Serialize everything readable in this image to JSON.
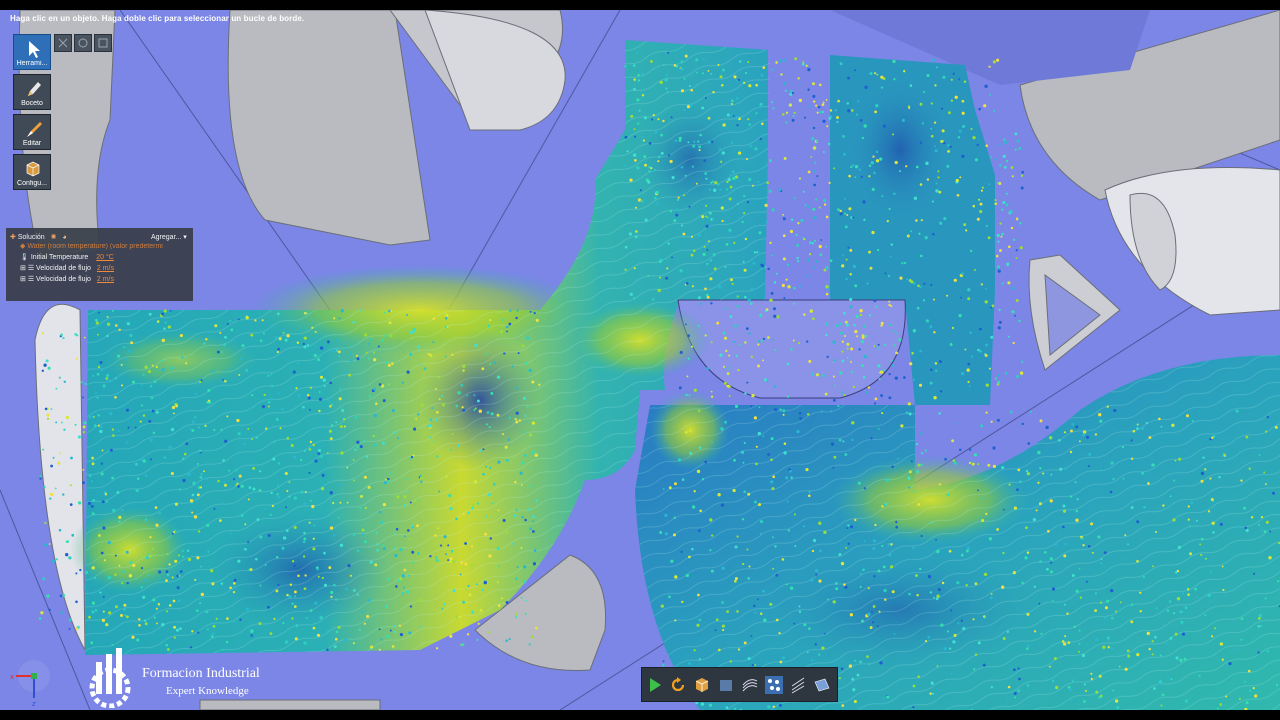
{
  "status_hint": "Haga clic en un objeto. Haga doble clic para seleccionar un bucle de borde.",
  "left_toolbar": [
    {
      "label": "Herrami...",
      "icon": "cursor-arrow-icon",
      "active": true
    },
    {
      "label": "Boceto",
      "icon": "pencil-icon",
      "active": false
    },
    {
      "label": "Editar",
      "icon": "edit-brush-icon",
      "active": false
    },
    {
      "label": "Configu...",
      "icon": "cube-settings-icon",
      "active": false
    }
  ],
  "mini_tools": [
    "select-mode-icon",
    "rotate-view-icon",
    "zoom-view-icon"
  ],
  "solution_panel": {
    "title": "Solución",
    "add_button": "Agregar...",
    "material": "Water (room temperature) (valor predetermi",
    "items": [
      {
        "label": "Initial Temperature",
        "value": "20 °C"
      },
      {
        "label": "Velocidad de flujo",
        "value": "2 m/s"
      },
      {
        "label": "Velocidad de flujo",
        "value": "2 m/s"
      }
    ]
  },
  "bottom_toolbar": [
    "play-icon",
    "refresh-icon",
    "cube-icon",
    "box-icon",
    "streamlines-icon",
    "particles-icon",
    "flow-lines-icon",
    "plane-icon"
  ],
  "watermark": {
    "title": "Formacion Industrial",
    "subtitle": "Expert Knowledge"
  },
  "axis_triad": {
    "x": "x",
    "z": "z"
  },
  "colors": {
    "background": "#7b86e6",
    "solid": "#b8babf",
    "flow_low": "#1f4ec0",
    "flow_mid": "#2bb3b8",
    "flow_high": "#d9e62a"
  }
}
